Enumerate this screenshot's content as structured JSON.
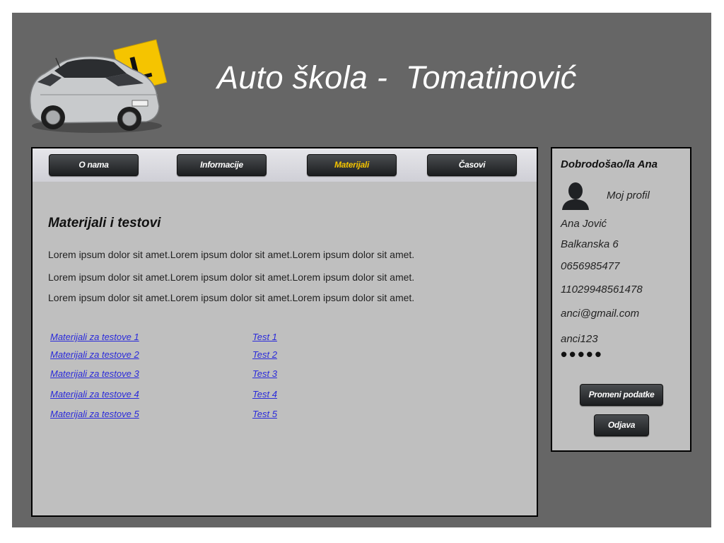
{
  "header": {
    "title": "Auto škola -  Tomatinović",
    "logo_letter": "L"
  },
  "nav": {
    "items": [
      {
        "label": "O nama",
        "active": false
      },
      {
        "label": "Informacije",
        "active": false
      },
      {
        "label": "Materijali",
        "active": true
      },
      {
        "label": "Časovi",
        "active": false
      }
    ]
  },
  "main": {
    "title": "Materijali i testovi",
    "paragraphs": [
      "Lorem ipsum dolor sit amet.Lorem ipsum dolor sit amet.Lorem ipsum dolor sit amet.",
      "Lorem ipsum dolor sit amet.Lorem ipsum dolor sit amet.Lorem ipsum dolor sit amet.",
      "Lorem ipsum dolor sit amet.Lorem ipsum dolor sit amet.Lorem ipsum dolor sit amet."
    ],
    "material_links": [
      "Materijali za testove 1",
      "Materijali za testove 2",
      "Materijali za testove 3",
      "Materijali za testove 4",
      "Materijali za testove 5"
    ],
    "test_links": [
      "Test 1",
      "Test 2",
      "Test 3",
      "Test 4",
      "Test 5"
    ]
  },
  "sidebar": {
    "welcome": "Dobrodošao/la Ana",
    "profile_link": "Moj profil",
    "name": "Ana Jović",
    "address": "Balkanska 6",
    "phone": "0656985477",
    "jmbg": "11029948561478",
    "email": "anci@gmail.com",
    "username": "anci123",
    "password_mask": "•••••",
    "change_button": "Promeni podatke",
    "logout_button": "Odjava"
  },
  "colors": {
    "frame": "#666666",
    "panel": "#bfbfbf",
    "active_nav": "#f5c400",
    "link": "#2a2adb",
    "logo_badge": "#f5c400"
  }
}
